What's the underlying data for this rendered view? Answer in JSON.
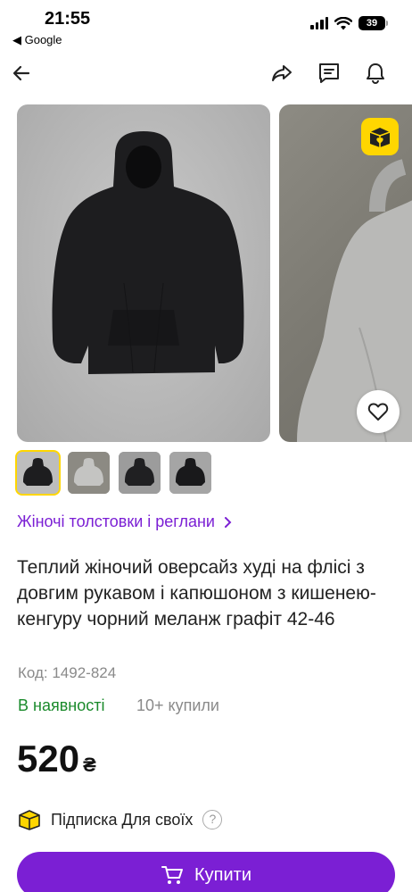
{
  "status_bar": {
    "time": "21:55",
    "back_app": "◀ Google",
    "battery": "39"
  },
  "gallery": {
    "photos": [
      "black hoodie",
      "grey hoodie"
    ],
    "thumbnails": 4,
    "active_thumbnail": 1
  },
  "breadcrumb": {
    "category": "Жіночі толстовки і реглани"
  },
  "product": {
    "title": "Теплий жіночий оверсайз худі на флісі з довгим рукавом і капюшоном з кишенею-кенгуру чорний меланж графіт 42-46",
    "code": "Код: 1492-824",
    "availability": "В наявності",
    "bought": "10+ купили",
    "price": "520",
    "currency": "₴"
  },
  "subscription": {
    "label": "Підписка Для своїх",
    "help": "?"
  },
  "buy_button": {
    "label": "Купити"
  },
  "colors": {
    "accent": "#7b1fd4",
    "in_stock": "#1a8a2b",
    "badge": "#ffd600"
  },
  "icons": [
    "back-arrow-icon",
    "share-icon",
    "chat-icon",
    "bell-icon",
    "box-icon",
    "heart-icon",
    "chevron-right-icon",
    "cart-icon"
  ]
}
